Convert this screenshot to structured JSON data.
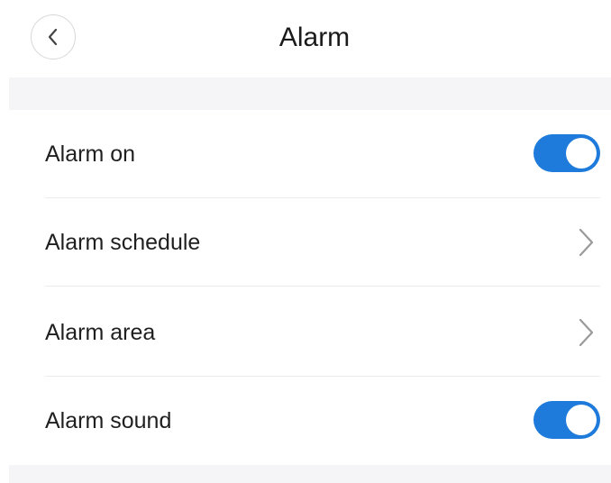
{
  "header": {
    "title": "Alarm",
    "back_icon": "chevron-left-icon"
  },
  "colors": {
    "accent": "#1e7bdb",
    "section_band": "#f5f5f7",
    "divider": "#ececec",
    "chevron": "#9a9a9a"
  },
  "settings": {
    "alarm_on": {
      "label": "Alarm on",
      "control": "toggle",
      "on": true
    },
    "alarm_schedule": {
      "label": "Alarm schedule",
      "control": "chevron-right-icon"
    },
    "alarm_area": {
      "label": "Alarm area",
      "control": "chevron-right-icon"
    },
    "alarm_sound": {
      "label": "Alarm sound",
      "control": "toggle",
      "on": true
    }
  }
}
